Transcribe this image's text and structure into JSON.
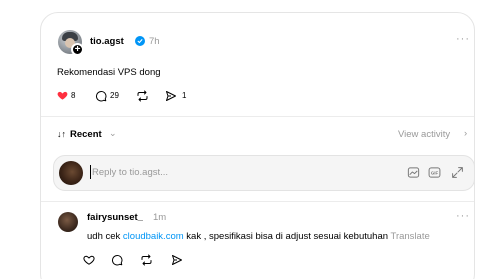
{
  "post": {
    "username": "tio.agst",
    "verified": true,
    "time": "7h",
    "more": "···",
    "text": "Rekomendasi VPS dong",
    "like_count": "8",
    "comment_count": "29",
    "share_count": "1",
    "icons": [
      "plus-icon",
      "verified-icon",
      "heart-icon",
      "comment-icon",
      "repost-icon",
      "share-icon"
    ]
  },
  "replies_header": {
    "sort_icon": "↓↑",
    "sort_label": "Recent",
    "sort_chevron": "⌄",
    "view_activity": "View activity",
    "view_activity_chevron": "›"
  },
  "reply_box": {
    "placeholder": "Reply to tio.agst...",
    "icons": [
      "image-icon",
      "gif-icon",
      "expand-icon"
    ]
  },
  "comment": {
    "username": "fairysunset_",
    "time": "1m",
    "more": "···",
    "text_before": "udh cek ",
    "link": "cloudbaik.com",
    "text_after": " kak , spesifikasi bisa di adjust sesuai kebutuhan",
    "translate": "Translate",
    "icons": [
      "heart-icon",
      "comment-icon",
      "repost-icon",
      "share-icon"
    ]
  },
  "colors": {
    "like_red": "#ff3040",
    "verified_blue": "#0095f6",
    "link_blue": "#0095f6",
    "muted_gray": "#999999"
  }
}
